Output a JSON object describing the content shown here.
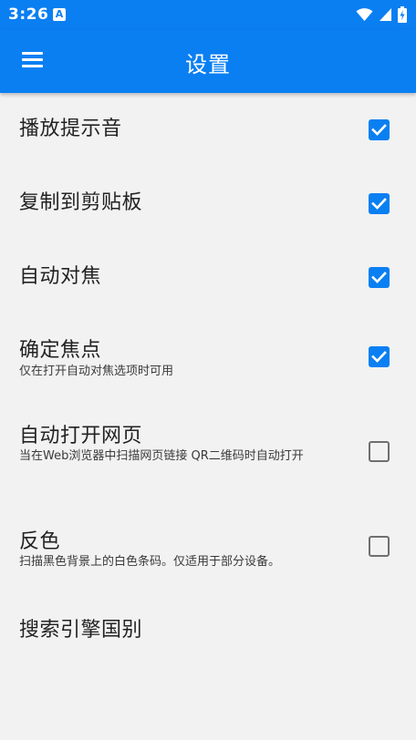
{
  "status_bar": {
    "time": "3:26",
    "notification_icon_letter": "A",
    "icons": [
      "wifi-icon",
      "cell-signal-icon",
      "battery-charging-icon"
    ]
  },
  "app_bar": {
    "title": "设置",
    "menu_icon": "hamburger-menu-icon"
  },
  "colors": {
    "primary": "#0a7ff2",
    "background": "#f2f2f2",
    "text": "#222222",
    "unchecked_box": "#6f6f6f"
  },
  "settings": [
    {
      "title": "播放提示音",
      "summary": "",
      "checked": true
    },
    {
      "title": "复制到剪贴板",
      "summary": "",
      "checked": true
    },
    {
      "title": "自动对焦",
      "summary": "",
      "checked": true
    },
    {
      "title": "确定焦点",
      "summary": "仅在打开自动对焦选项时可用",
      "checked": true
    },
    {
      "title": "自动打开网页",
      "summary": "当在Web浏览器中扫描网页链接 QR二维码时自动打开",
      "checked": false
    },
    {
      "title": "反色",
      "summary": "扫描黑色背景上的白色条码。仅适用于部分设备。",
      "checked": false
    },
    {
      "title": "搜索引擎国别",
      "summary": ""
    }
  ]
}
